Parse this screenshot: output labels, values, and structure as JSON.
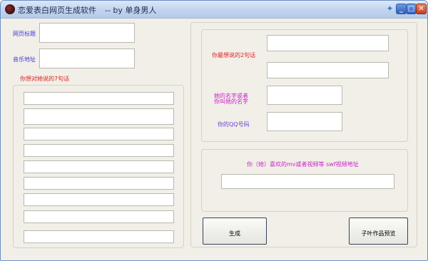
{
  "window": {
    "title": "恋爱表白网页生成软件",
    "subtitle": "-- by 单身男人",
    "buttons": [
      "pin-icon",
      "minimize-icon",
      "maximize-icon",
      "close-icon"
    ]
  },
  "left": {
    "page_title_label": "网页标题",
    "page_title_value": "",
    "music_label": "音乐地址",
    "music_value": "",
    "words_label": "你想对她说的7句话",
    "lines": [
      "",
      "",
      "",
      "",
      "",
      "",
      "",
      "",
      ""
    ]
  },
  "right": {
    "two_lines_label": "你最想说的2句话",
    "line1": "",
    "line2": "",
    "name_label_1": "她的名字或者",
    "name_label_2": "你叫她的名字",
    "name_value": "",
    "qq_label": "你的QQ号码",
    "qq_value": "",
    "video_label": "你（她）喜欢的mv或者视频等  swf视频地址",
    "video_value": ""
  },
  "actions": {
    "generate": "生成",
    "preview": "子叶作品预览"
  }
}
